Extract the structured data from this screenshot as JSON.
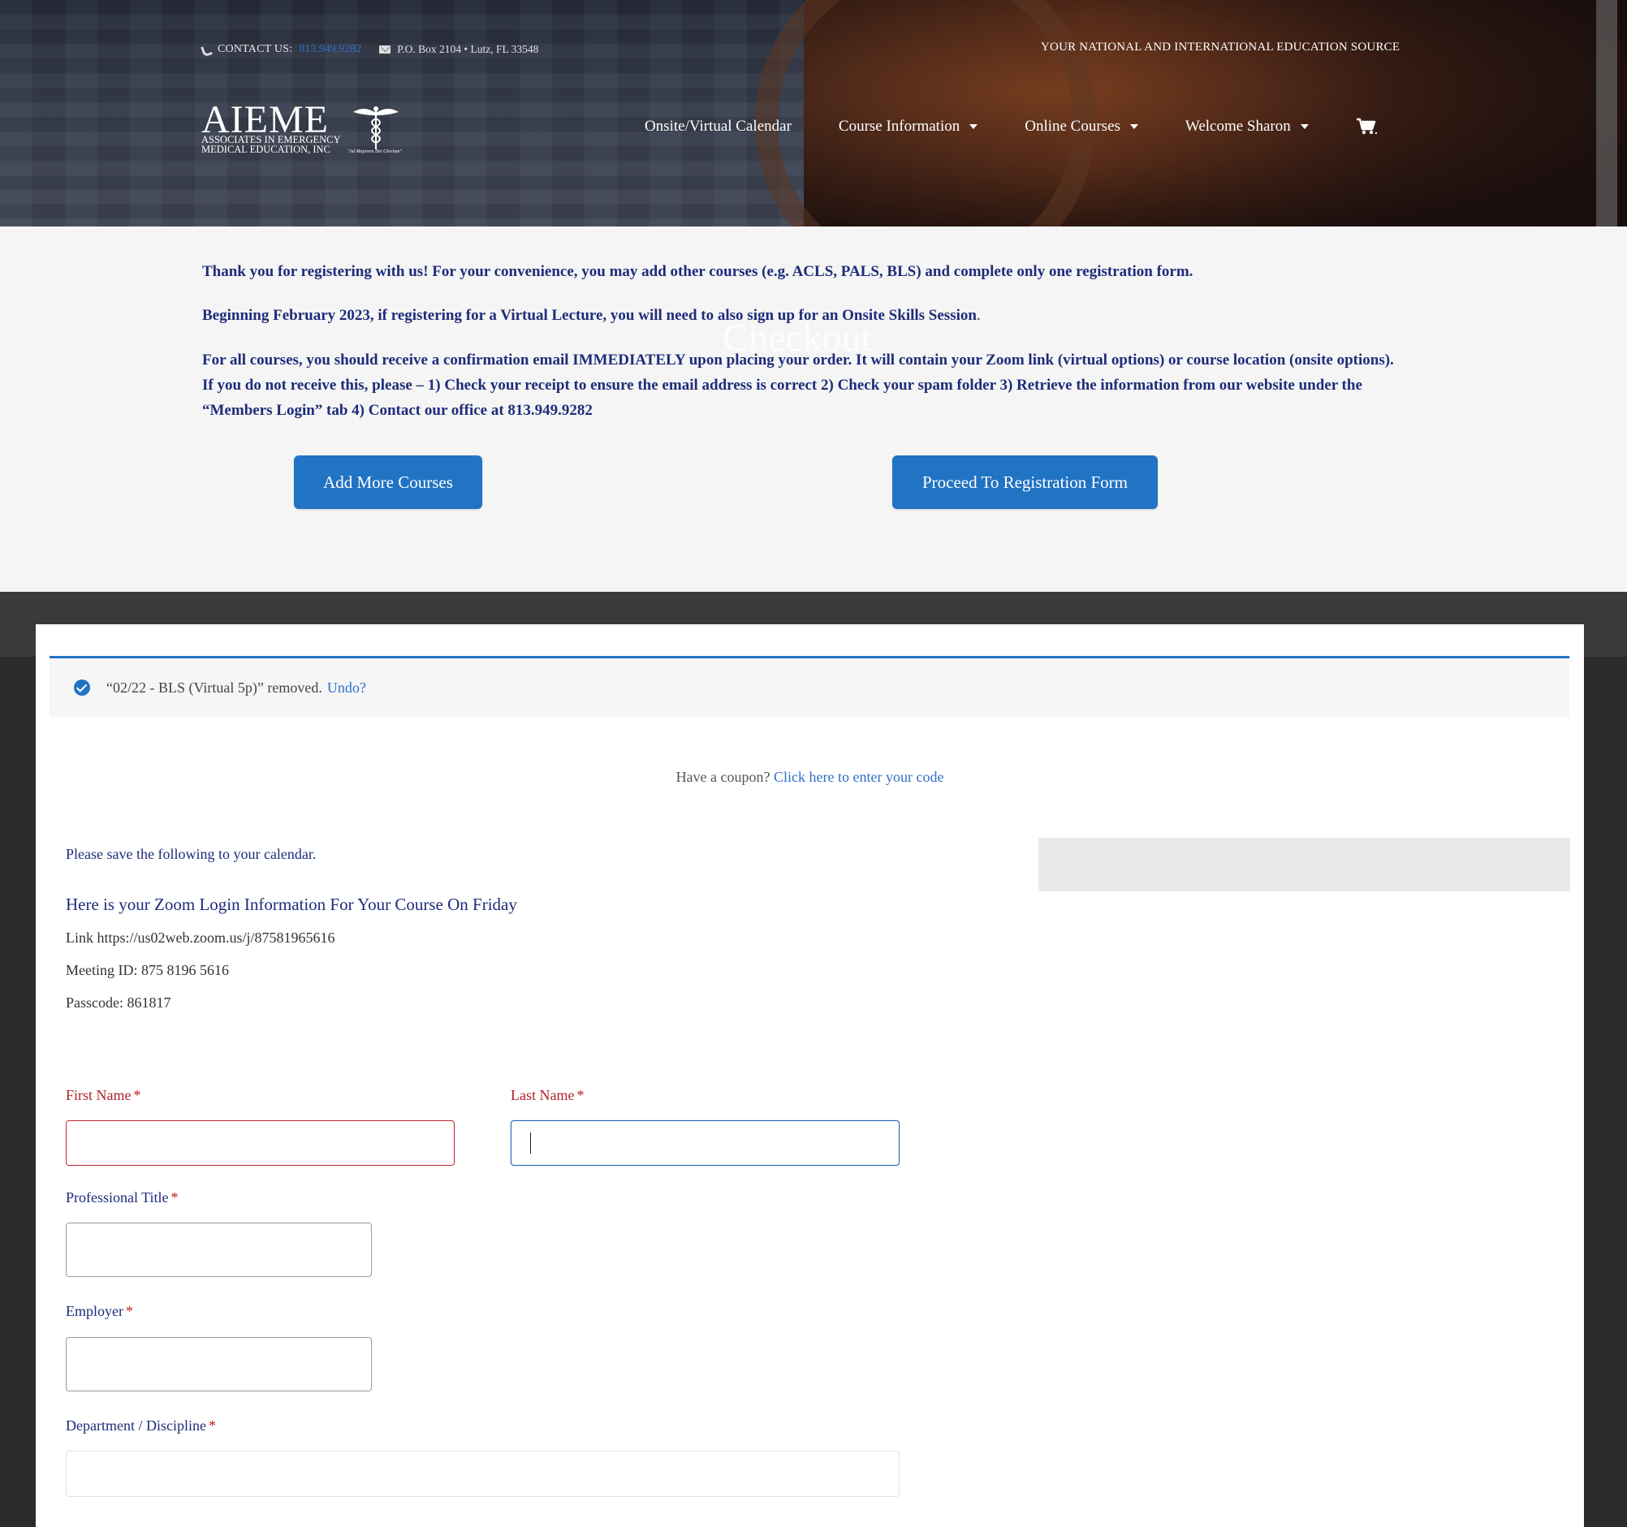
{
  "topbar": {
    "contact_label": "CONTACT US:",
    "contact_phone": "813.949.9282",
    "address": "P.O. Box 2104 • Lutz, FL 33548",
    "tagline": "YOUR NATIONAL AND INTERNATIONAL EDUCATION SOURCE"
  },
  "logo": {
    "wordmark": "AIEME",
    "line1": "ASSOCIATES IN EMERGENCY",
    "line2": "MEDICAL EDUCATION, INC",
    "motto": "\"Ad Majorem Dei Gloriam\""
  },
  "nav": {
    "calendar": "Onsite/Virtual Calendar",
    "course_info": "Course Information",
    "online_courses": "Online Courses",
    "welcome": "Welcome Sharon"
  },
  "notice": {
    "ghost_title": "Checkout",
    "p1": "Thank you for registering with us! For your convenience, you may add other courses (e.g. ACLS, PALS, BLS) and complete only one registration form.",
    "p2": "Beginning February 2023, if registering for a Virtual Lecture, you will need to also sign up for an Onsite Skills Session",
    "p2_end": ".",
    "p3": "For all courses, you should receive a confirmation email IMMEDIATELY upon placing your order. It will contain your Zoom link (virtual options) or course location (onsite options). If you do not receive this, please – 1) Check your receipt to ensure the email address is correct 2) Check your spam folder 3) Retrieve the information from our website under the “Members Login” tab 4) Contact our office at 813.949.9282",
    "add_more_label": "Add More Courses",
    "proceed_label": "Proceed To Registration Form"
  },
  "alert": {
    "message": "“02/22 - BLS (Virtual 5p)” removed.",
    "undo_label": "Undo?"
  },
  "coupon": {
    "prompt": "Have a coupon?",
    "link": "Click here to enter your code"
  },
  "zoom": {
    "calendar_note": "Please save the following to your calendar.",
    "heading": "Here is your Zoom Login Information For Your Course On Friday",
    "link": "Link https://us02web.zoom.us/j/87581965616",
    "meeting_id": "Meeting ID: 875 8196 5616",
    "passcode": "Passcode: 861817"
  },
  "form": {
    "first_name_label": "First Name",
    "last_name_label": "Last Name",
    "professional_title_label": "Professional Title",
    "employer_label": "Employer",
    "department_label": "Department / Discipline",
    "required_mark": "*",
    "first_name_value": "",
    "last_name_value": "",
    "professional_title_value": "",
    "employer_value": "",
    "department_value": ""
  },
  "colors": {
    "brand_blue": "#2173c4",
    "navy_text": "#1e2c7a",
    "error_red": "#b0232a"
  },
  "icons": [
    "phone-icon",
    "mail-icon",
    "caduceus-icon",
    "chevron-down-icon",
    "cart-icon",
    "check-circle-icon"
  ]
}
